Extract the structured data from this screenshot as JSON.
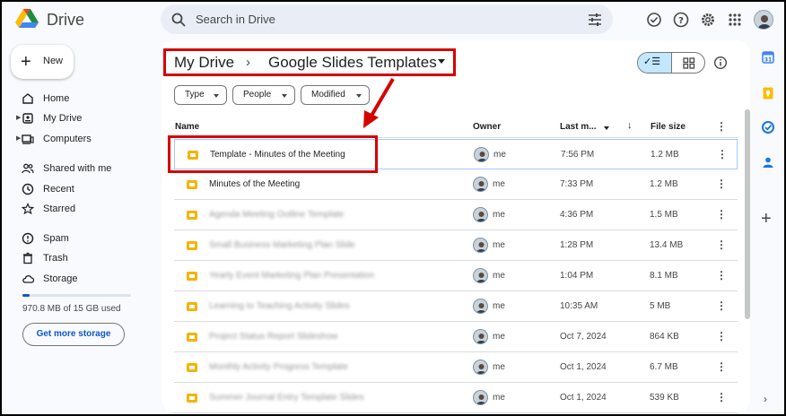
{
  "app": {
    "title": "Drive"
  },
  "search": {
    "placeholder": "Search in Drive"
  },
  "sidebar": {
    "new_label": "New",
    "items": [
      {
        "label": "Home",
        "icon": "home-icon"
      },
      {
        "label": "My Drive",
        "icon": "drive-icon",
        "expandable": true
      },
      {
        "label": "Computers",
        "icon": "computer-icon",
        "expandable": true
      },
      {
        "label": "Shared with me",
        "icon": "people-icon"
      },
      {
        "label": "Recent",
        "icon": "clock-icon"
      },
      {
        "label": "Starred",
        "icon": "star-icon"
      },
      {
        "label": "Spam",
        "icon": "spam-icon"
      },
      {
        "label": "Trash",
        "icon": "trash-icon"
      },
      {
        "label": "Storage",
        "icon": "cloud-icon"
      }
    ],
    "storage": {
      "used_text": "970.8 MB of 15 GB used",
      "used_fraction": 0.065,
      "cta": "Get more storage"
    }
  },
  "breadcrumb": {
    "root": "My Drive",
    "separator": "›",
    "current": "Google Slides Templates"
  },
  "filters": [
    {
      "label": "Type"
    },
    {
      "label": "People"
    },
    {
      "label": "Modified"
    }
  ],
  "view": {
    "list_selected": true
  },
  "table": {
    "columns": {
      "name": "Name",
      "owner": "Owner",
      "modified": "Last m...",
      "size": "File size"
    },
    "rows": [
      {
        "name": "Template - Minutes of the Meeting",
        "owner": "me",
        "modified": "7:56 PM",
        "size": "1.2 MB",
        "selected": true,
        "blurred": false
      },
      {
        "name": "Minutes of the Meeting",
        "owner": "me",
        "modified": "7:33 PM",
        "size": "1.2 MB",
        "selected": false,
        "blurred": false
      },
      {
        "name": "Agenda Meeting Outline Template",
        "owner": "me",
        "modified": "4:36 PM",
        "size": "1.5 MB",
        "selected": false,
        "blurred": true
      },
      {
        "name": "Small Business Marketing Plan Slide",
        "owner": "me",
        "modified": "1:28 PM",
        "size": "13.4 MB",
        "selected": false,
        "blurred": true
      },
      {
        "name": "Yearly Event Marketing Plan Presentation",
        "owner": "me",
        "modified": "1:04 PM",
        "size": "8.1 MB",
        "selected": false,
        "blurred": true
      },
      {
        "name": "Learning to Teaching Activity Slides",
        "owner": "me",
        "modified": "10:35 AM",
        "size": "5 MB",
        "selected": false,
        "blurred": true
      },
      {
        "name": "Project Status Report Slideshow",
        "owner": "me",
        "modified": "Oct 7, 2024",
        "size": "864 KB",
        "selected": false,
        "blurred": true
      },
      {
        "name": "Monthly Activity Progress Template",
        "owner": "me",
        "modified": "Oct 1, 2024",
        "size": "6.7 MB",
        "selected": false,
        "blurred": true
      },
      {
        "name": "Summer Journal Entry Template Slides",
        "owner": "me",
        "modified": "Oct 1, 2024",
        "size": "539 KB",
        "selected": false,
        "blurred": true
      }
    ]
  },
  "colors": {
    "accent": "#0b57d0",
    "annotation": "#d50000",
    "slides_icon": "#f4b400"
  }
}
